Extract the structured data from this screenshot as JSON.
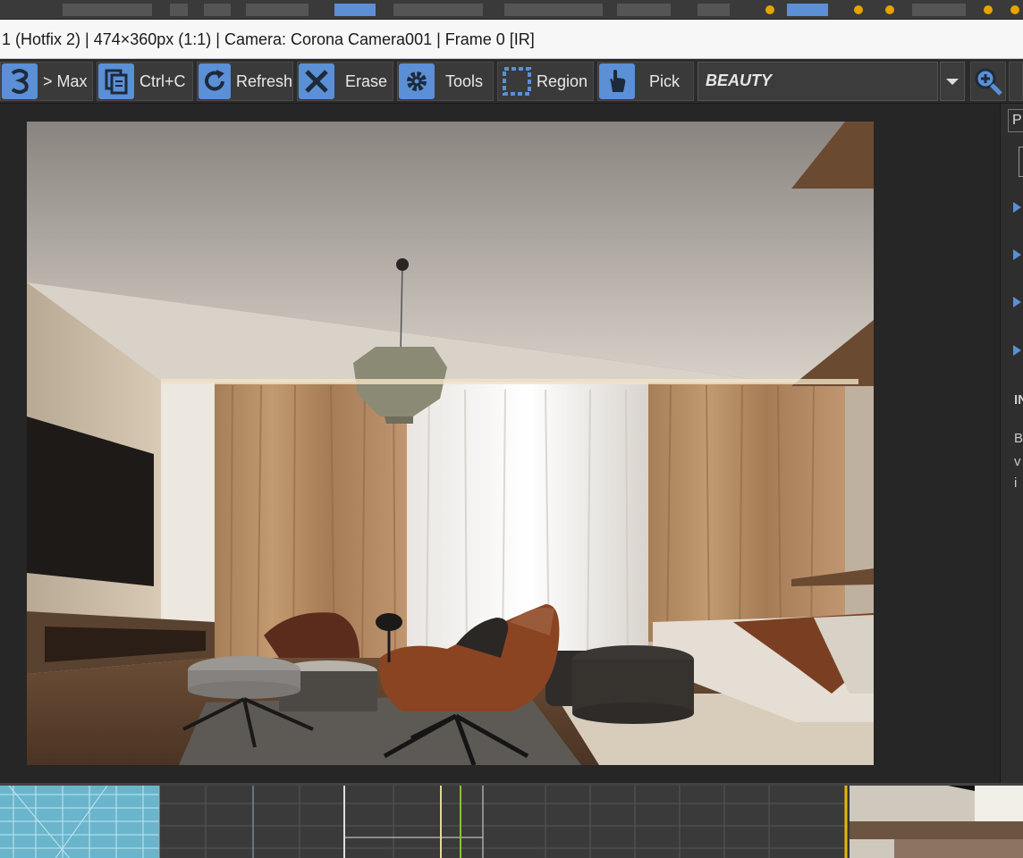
{
  "window": {
    "title": "1 (Hotfix 2) | 474×360px (1:1) | Camera: Corona Camera001 | Frame 0 [IR]"
  },
  "toolbar": {
    "max_label": "> Max",
    "copy_label": "Ctrl+C",
    "refresh_label": "Refresh",
    "erase_label": "Erase",
    "tools_label": "Tools",
    "region_label": "Region",
    "pick_label": "Pick",
    "channel_value": "BEAUTY"
  },
  "side_panel": {
    "tab_label": "P",
    "section_label": "IN",
    "info_lines": [
      "B",
      "v",
      "i"
    ]
  },
  "colors": {
    "accent": "#5b8fd6",
    "toolbar_bg": "#2b2b2b",
    "title_bg": "#f7f7f7"
  }
}
